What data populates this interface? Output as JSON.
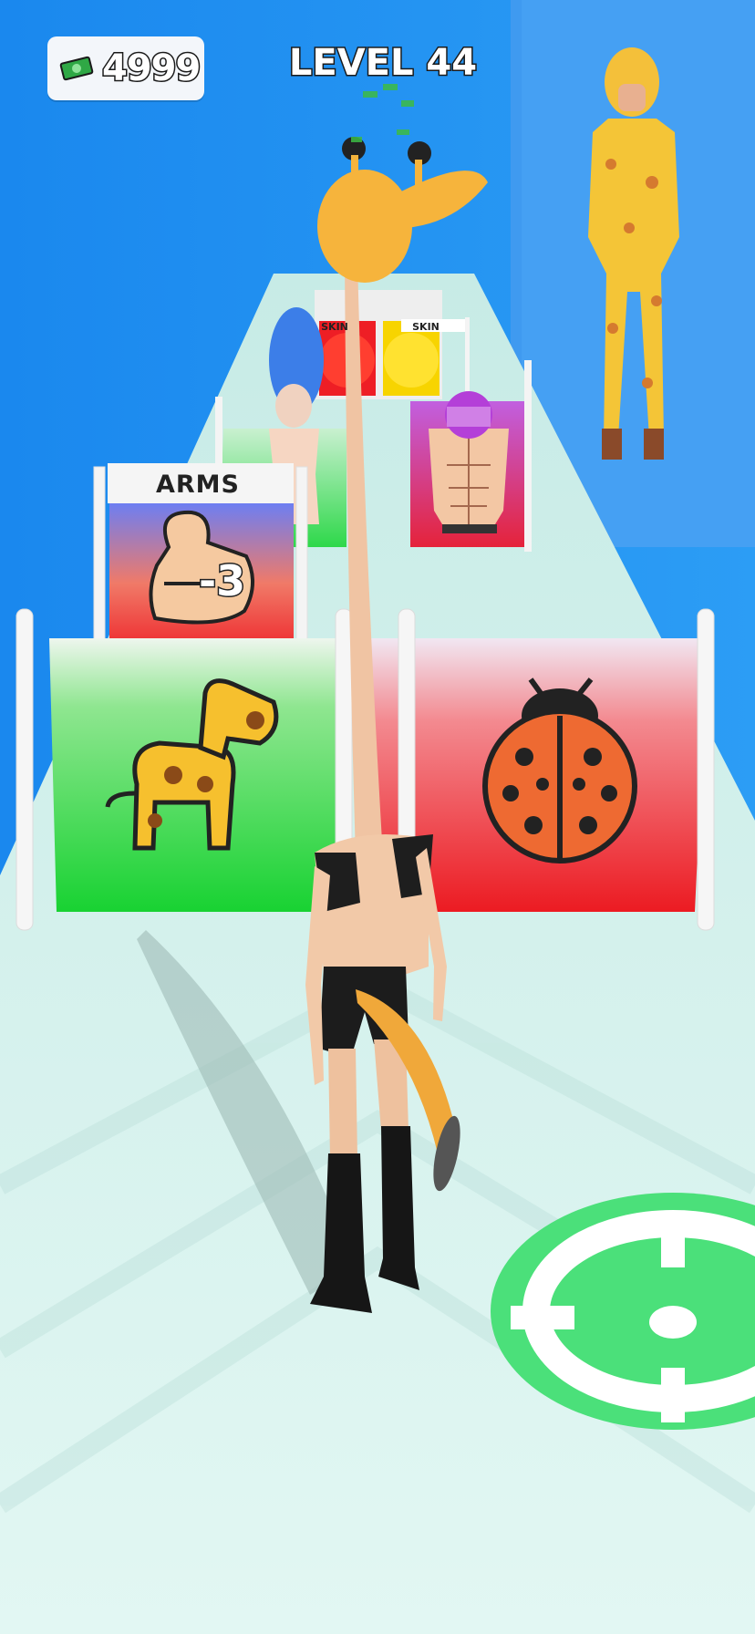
{
  "hud": {
    "money": "4999",
    "money_icon": "cash-icon",
    "level": "LEVEL 44"
  },
  "gates": {
    "near_left": {
      "icon": "giraffe-icon",
      "color": "#22d040"
    },
    "near_right": {
      "icon": "ladybug-icon",
      "color": "#e61e2a"
    },
    "arms": {
      "label": "ARMS",
      "value": "-3",
      "icon": "flexed-arm-icon"
    },
    "far_left_skin": {
      "label": "SKIN",
      "color": "#e61e2a"
    },
    "far_right_skin": {
      "label": "SKIN",
      "color": "#f7d400"
    }
  },
  "colors": {
    "sky": "#1e8ff0",
    "track": "#d6f3ee",
    "target": "#4be07a"
  }
}
